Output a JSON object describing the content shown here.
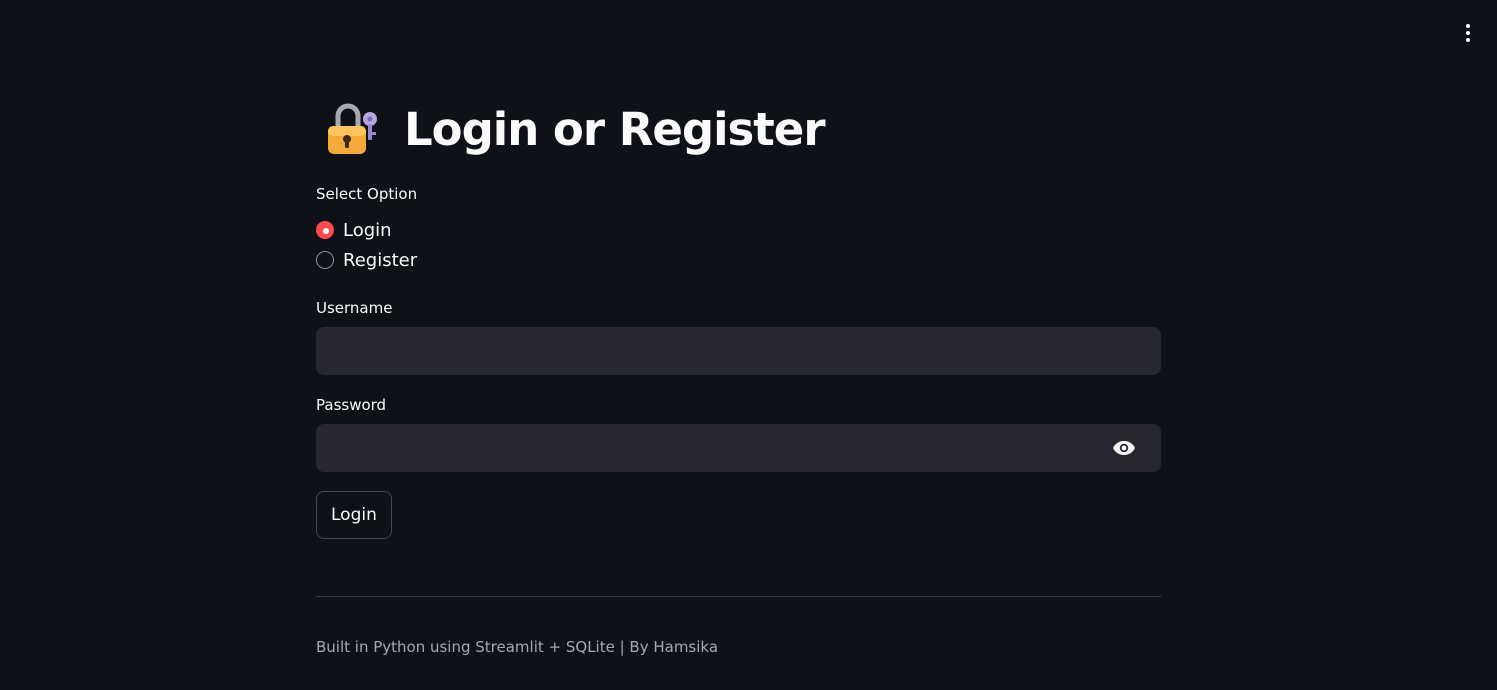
{
  "header": {
    "menu_icon": "vertical-ellipsis-icon"
  },
  "page": {
    "title_icon": "locked-with-key-icon",
    "title": "Login or Register"
  },
  "option_select": {
    "label": "Select Option",
    "options": [
      {
        "label": "Login",
        "selected": true
      },
      {
        "label": "Register",
        "selected": false
      }
    ],
    "accent_color": "#ff4b4b"
  },
  "username": {
    "label": "Username",
    "value": "",
    "placeholder": ""
  },
  "password": {
    "label": "Password",
    "value": "",
    "placeholder": "",
    "toggle_icon": "eye-icon"
  },
  "actions": {
    "login_label": "Login"
  },
  "footer": {
    "text": "Built in Python using Streamlit + SQLite | By Hamsika"
  },
  "colors": {
    "background": "#0e1117",
    "input_background": "#262730",
    "text": "#fafafa",
    "muted_text": "#a3a8b4"
  }
}
